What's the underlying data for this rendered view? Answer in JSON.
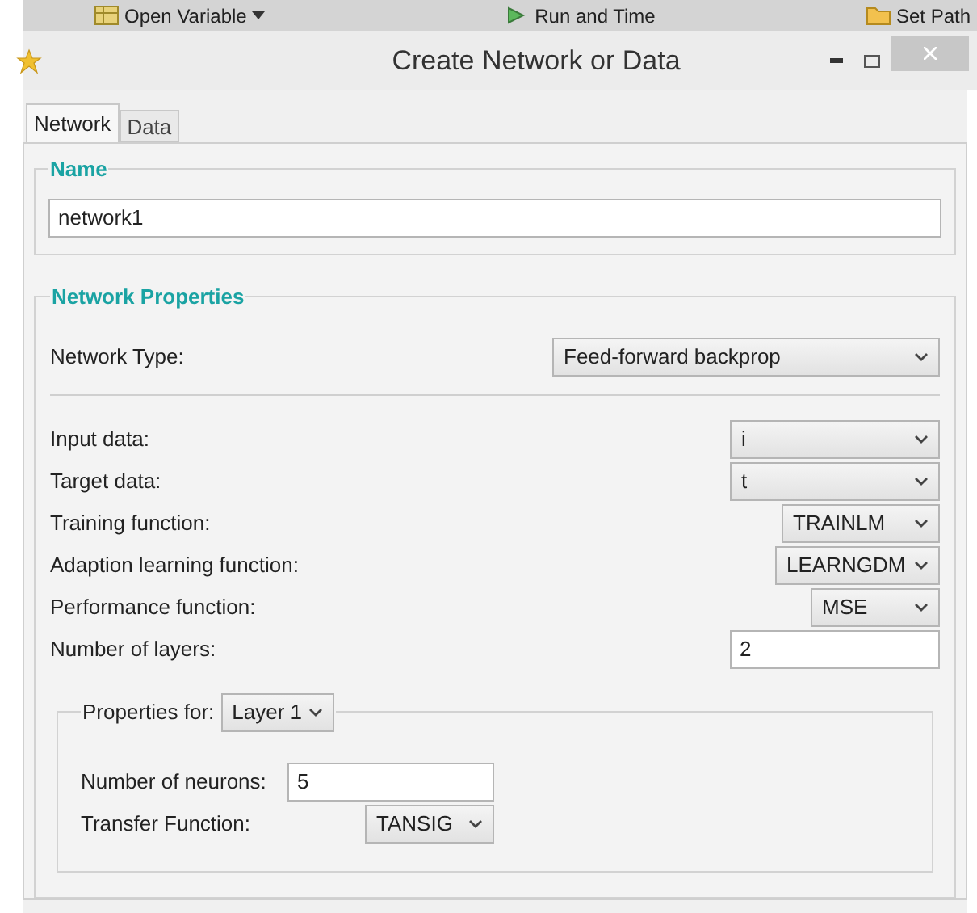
{
  "toolbar": [
    {
      "label": "Open Variable",
      "kind": "dropdown"
    },
    {
      "label": "Run and Time",
      "kind": "button"
    },
    {
      "label": "Set Path",
      "kind": "button"
    }
  ],
  "window": {
    "title": "Create Network or Data"
  },
  "tabs": [
    {
      "label": "Network",
      "selected": true
    },
    {
      "label": "Data",
      "selected": false
    }
  ],
  "name_section": {
    "title": "Name",
    "value": "network1"
  },
  "properties": {
    "title": "Network Properties",
    "network_type": {
      "label": "Network Type:",
      "value": "Feed-forward backprop"
    },
    "fields": [
      {
        "label": "Input data:",
        "kind": "dropdown",
        "value": "i"
      },
      {
        "label": "Target data:",
        "kind": "dropdown",
        "value": "t"
      },
      {
        "label": "Training function:",
        "kind": "dropdown",
        "value": "TRAINLM"
      },
      {
        "label": "Adaption learning function:",
        "kind": "dropdown",
        "value": "LEARNGDM"
      },
      {
        "label": "Performance function:",
        "kind": "dropdown",
        "value": "MSE"
      },
      {
        "label": "Number of layers:",
        "kind": "input",
        "value": "2"
      }
    ]
  },
  "layer": {
    "label": "Properties for:",
    "value": "Layer 1",
    "fields": [
      {
        "label": "Number of neurons:",
        "kind": "input",
        "value": "5"
      },
      {
        "label": "Transfer Function:",
        "kind": "dropdown",
        "value": "TANSIG"
      }
    ]
  }
}
